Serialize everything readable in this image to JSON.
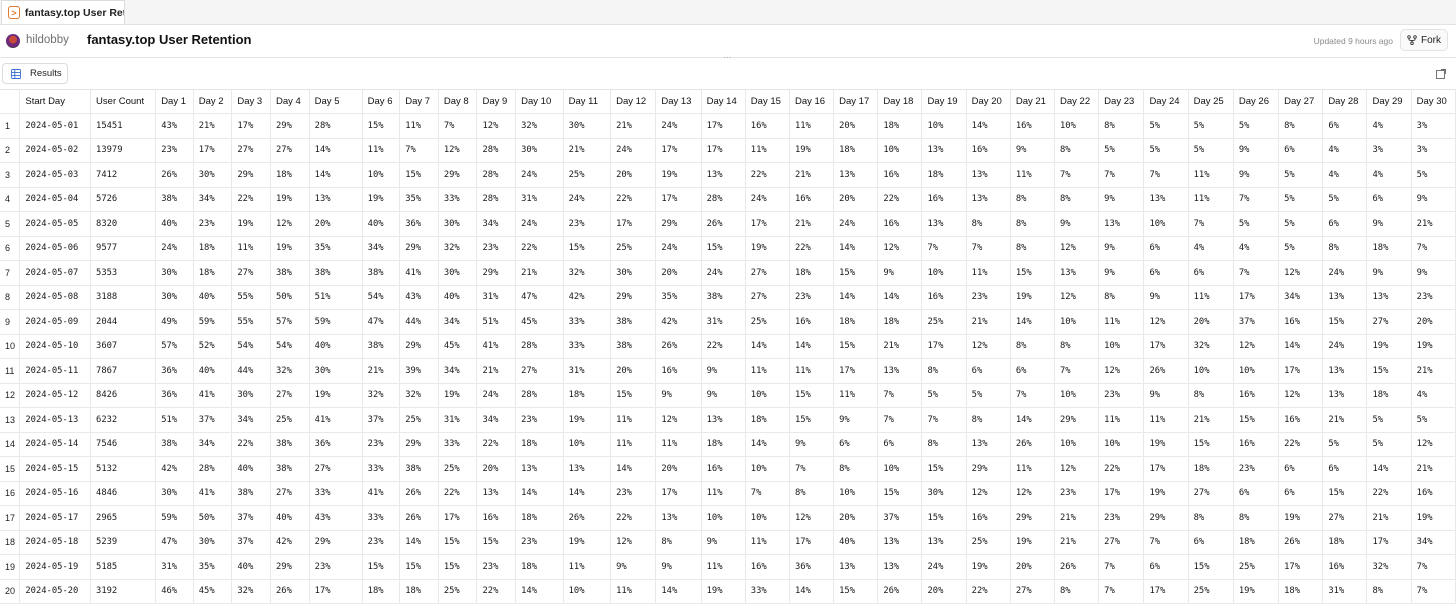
{
  "tab": {
    "label": "fantasy.top User Ret...",
    "icon": "query-icon"
  },
  "header": {
    "username": "hildobby",
    "title": "fantasy.top User Retention",
    "updated": "Updated 9 hours ago",
    "fork_label": "Fork"
  },
  "toolbar": {
    "results_label": "Results"
  },
  "table": {
    "columns": [
      "",
      "Start Day",
      "User Count",
      "Day 1",
      "Day 2",
      "Day 3",
      "Day 4",
      "Day 5",
      "Day 6",
      "Day 7",
      "Day 8",
      "Day 9",
      "Day 10",
      "Day 11",
      "Day 12",
      "Day 13",
      "Day 14",
      "Day 15",
      "Day 16",
      "Day 17",
      "Day 18",
      "Day 19",
      "Day 20",
      "Day 21",
      "Day 22",
      "Day 23",
      "Day 24",
      "Day 25",
      "Day 26",
      "Day 27",
      "Day 28",
      "Day 29",
      "Day 30"
    ],
    "rows": [
      [
        "1",
        "2024-05-01",
        "15451",
        "43%",
        "21%",
        "17%",
        "29%",
        "28%",
        "15%",
        "11%",
        "7%",
        "12%",
        "32%",
        "30%",
        "21%",
        "24%",
        "17%",
        "16%",
        "11%",
        "20%",
        "18%",
        "10%",
        "14%",
        "16%",
        "10%",
        "8%",
        "5%",
        "5%",
        "5%",
        "8%",
        "6%",
        "4%",
        "3%"
      ],
      [
        "2",
        "2024-05-02",
        "13979",
        "23%",
        "17%",
        "27%",
        "27%",
        "14%",
        "11%",
        "7%",
        "12%",
        "28%",
        "30%",
        "21%",
        "24%",
        "17%",
        "17%",
        "11%",
        "19%",
        "18%",
        "10%",
        "13%",
        "16%",
        "9%",
        "8%",
        "5%",
        "5%",
        "5%",
        "9%",
        "6%",
        "4%",
        "3%",
        "3%"
      ],
      [
        "3",
        "2024-05-03",
        "7412",
        "26%",
        "30%",
        "29%",
        "18%",
        "14%",
        "10%",
        "15%",
        "29%",
        "28%",
        "24%",
        "25%",
        "20%",
        "19%",
        "13%",
        "22%",
        "21%",
        "13%",
        "16%",
        "18%",
        "13%",
        "11%",
        "7%",
        "7%",
        "7%",
        "11%",
        "9%",
        "5%",
        "4%",
        "4%",
        "5%"
      ],
      [
        "4",
        "2024-05-04",
        "5726",
        "38%",
        "34%",
        "22%",
        "19%",
        "13%",
        "19%",
        "35%",
        "33%",
        "28%",
        "31%",
        "24%",
        "22%",
        "17%",
        "28%",
        "24%",
        "16%",
        "20%",
        "22%",
        "16%",
        "13%",
        "8%",
        "8%",
        "9%",
        "13%",
        "11%",
        "7%",
        "5%",
        "5%",
        "6%",
        "9%"
      ],
      [
        "5",
        "2024-05-05",
        "8320",
        "40%",
        "23%",
        "19%",
        "12%",
        "20%",
        "40%",
        "36%",
        "30%",
        "34%",
        "24%",
        "23%",
        "17%",
        "29%",
        "26%",
        "17%",
        "21%",
        "24%",
        "16%",
        "13%",
        "8%",
        "8%",
        "9%",
        "13%",
        "10%",
        "7%",
        "5%",
        "5%",
        "6%",
        "9%",
        "21%"
      ],
      [
        "6",
        "2024-05-06",
        "9577",
        "24%",
        "18%",
        "11%",
        "19%",
        "35%",
        "34%",
        "29%",
        "32%",
        "23%",
        "22%",
        "15%",
        "25%",
        "24%",
        "15%",
        "19%",
        "22%",
        "14%",
        "12%",
        "7%",
        "7%",
        "8%",
        "12%",
        "9%",
        "6%",
        "4%",
        "4%",
        "5%",
        "8%",
        "18%",
        "7%"
      ],
      [
        "7",
        "2024-05-07",
        "5353",
        "30%",
        "18%",
        "27%",
        "38%",
        "38%",
        "38%",
        "41%",
        "30%",
        "29%",
        "21%",
        "32%",
        "30%",
        "20%",
        "24%",
        "27%",
        "18%",
        "15%",
        "9%",
        "10%",
        "11%",
        "15%",
        "13%",
        "9%",
        "6%",
        "6%",
        "7%",
        "12%",
        "24%",
        "9%",
        "9%"
      ],
      [
        "8",
        "2024-05-08",
        "3188",
        "30%",
        "40%",
        "55%",
        "50%",
        "51%",
        "54%",
        "43%",
        "40%",
        "31%",
        "47%",
        "42%",
        "29%",
        "35%",
        "38%",
        "27%",
        "23%",
        "14%",
        "14%",
        "16%",
        "23%",
        "19%",
        "12%",
        "8%",
        "9%",
        "11%",
        "17%",
        "34%",
        "13%",
        "13%",
        "23%"
      ],
      [
        "9",
        "2024-05-09",
        "2044",
        "49%",
        "59%",
        "55%",
        "57%",
        "59%",
        "47%",
        "44%",
        "34%",
        "51%",
        "45%",
        "33%",
        "38%",
        "42%",
        "31%",
        "25%",
        "16%",
        "18%",
        "18%",
        "25%",
        "21%",
        "14%",
        "10%",
        "11%",
        "12%",
        "20%",
        "37%",
        "16%",
        "15%",
        "27%",
        "20%"
      ],
      [
        "10",
        "2024-05-10",
        "3607",
        "57%",
        "52%",
        "54%",
        "54%",
        "40%",
        "38%",
        "29%",
        "45%",
        "41%",
        "28%",
        "33%",
        "38%",
        "26%",
        "22%",
        "14%",
        "14%",
        "15%",
        "21%",
        "17%",
        "12%",
        "8%",
        "8%",
        "10%",
        "17%",
        "32%",
        "12%",
        "14%",
        "24%",
        "19%",
        "19%"
      ],
      [
        "11",
        "2024-05-11",
        "7867",
        "36%",
        "40%",
        "44%",
        "32%",
        "30%",
        "21%",
        "39%",
        "34%",
        "21%",
        "27%",
        "31%",
        "20%",
        "16%",
        "9%",
        "11%",
        "11%",
        "17%",
        "13%",
        "8%",
        "6%",
        "6%",
        "7%",
        "12%",
        "26%",
        "10%",
        "10%",
        "17%",
        "13%",
        "15%",
        "21%"
      ],
      [
        "12",
        "2024-05-12",
        "8426",
        "36%",
        "41%",
        "30%",
        "27%",
        "19%",
        "32%",
        "32%",
        "19%",
        "24%",
        "28%",
        "18%",
        "15%",
        "9%",
        "9%",
        "10%",
        "15%",
        "11%",
        "7%",
        "5%",
        "5%",
        "7%",
        "10%",
        "23%",
        "9%",
        "8%",
        "16%",
        "12%",
        "13%",
        "18%",
        "4%"
      ],
      [
        "13",
        "2024-05-13",
        "6232",
        "51%",
        "37%",
        "34%",
        "25%",
        "41%",
        "37%",
        "25%",
        "31%",
        "34%",
        "23%",
        "19%",
        "11%",
        "12%",
        "13%",
        "18%",
        "15%",
        "9%",
        "7%",
        "7%",
        "8%",
        "14%",
        "29%",
        "11%",
        "11%",
        "21%",
        "15%",
        "16%",
        "21%",
        "5%",
        "5%"
      ],
      [
        "14",
        "2024-05-14",
        "7546",
        "38%",
        "34%",
        "22%",
        "38%",
        "36%",
        "23%",
        "29%",
        "33%",
        "22%",
        "18%",
        "10%",
        "11%",
        "11%",
        "18%",
        "14%",
        "9%",
        "6%",
        "6%",
        "8%",
        "13%",
        "26%",
        "10%",
        "10%",
        "19%",
        "15%",
        "16%",
        "22%",
        "5%",
        "5%",
        "12%"
      ],
      [
        "15",
        "2024-05-15",
        "5132",
        "42%",
        "28%",
        "40%",
        "38%",
        "27%",
        "33%",
        "38%",
        "25%",
        "20%",
        "13%",
        "13%",
        "14%",
        "20%",
        "16%",
        "10%",
        "7%",
        "8%",
        "10%",
        "15%",
        "29%",
        "11%",
        "12%",
        "22%",
        "17%",
        "18%",
        "23%",
        "6%",
        "6%",
        "14%",
        "21%"
      ],
      [
        "16",
        "2024-05-16",
        "4846",
        "30%",
        "41%",
        "38%",
        "27%",
        "33%",
        "41%",
        "26%",
        "22%",
        "13%",
        "14%",
        "14%",
        "23%",
        "17%",
        "11%",
        "7%",
        "8%",
        "10%",
        "15%",
        "30%",
        "12%",
        "12%",
        "23%",
        "17%",
        "19%",
        "27%",
        "6%",
        "6%",
        "15%",
        "22%",
        "16%"
      ],
      [
        "17",
        "2024-05-17",
        "2965",
        "59%",
        "50%",
        "37%",
        "40%",
        "43%",
        "33%",
        "26%",
        "17%",
        "16%",
        "18%",
        "26%",
        "22%",
        "13%",
        "10%",
        "10%",
        "12%",
        "20%",
        "37%",
        "15%",
        "16%",
        "29%",
        "21%",
        "23%",
        "29%",
        "8%",
        "8%",
        "19%",
        "27%",
        "21%",
        "19%"
      ],
      [
        "18",
        "2024-05-18",
        "5239",
        "47%",
        "30%",
        "37%",
        "42%",
        "29%",
        "23%",
        "14%",
        "15%",
        "15%",
        "23%",
        "19%",
        "12%",
        "8%",
        "9%",
        "11%",
        "17%",
        "40%",
        "13%",
        "13%",
        "25%",
        "19%",
        "21%",
        "27%",
        "7%",
        "6%",
        "18%",
        "26%",
        "18%",
        "17%",
        "34%"
      ],
      [
        "19",
        "2024-05-19",
        "5185",
        "31%",
        "35%",
        "40%",
        "29%",
        "23%",
        "15%",
        "15%",
        "15%",
        "23%",
        "18%",
        "11%",
        "9%",
        "9%",
        "11%",
        "16%",
        "36%",
        "13%",
        "13%",
        "24%",
        "19%",
        "20%",
        "26%",
        "7%",
        "6%",
        "15%",
        "25%",
        "17%",
        "16%",
        "32%",
        "7%"
      ],
      [
        "20",
        "2024-05-20",
        "3192",
        "46%",
        "45%",
        "32%",
        "26%",
        "17%",
        "18%",
        "18%",
        "25%",
        "22%",
        "14%",
        "10%",
        "11%",
        "14%",
        "19%",
        "33%",
        "14%",
        "15%",
        "26%",
        "20%",
        "22%",
        "27%",
        "8%",
        "7%",
        "17%",
        "25%",
        "19%",
        "18%",
        "31%",
        "8%",
        "7%"
      ]
    ]
  }
}
